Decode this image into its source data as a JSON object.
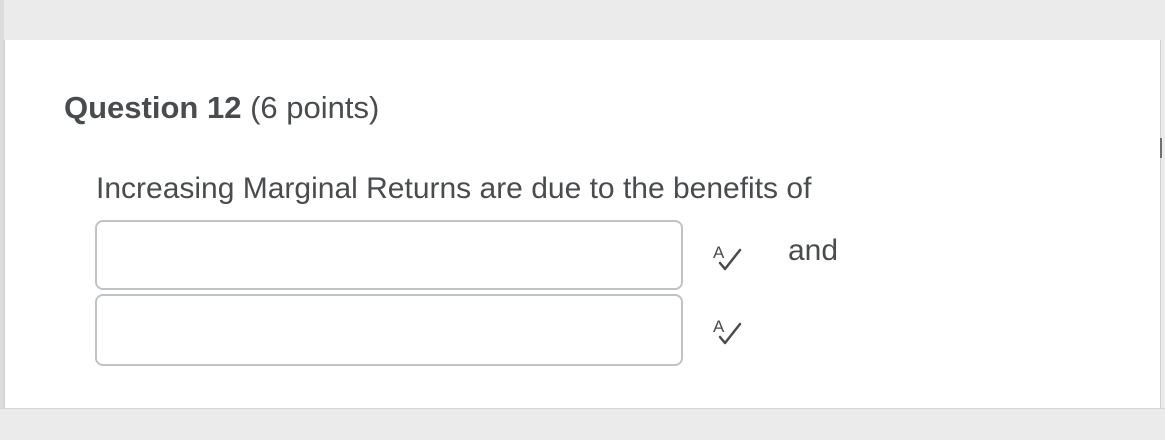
{
  "question": {
    "number_label": "Question 12",
    "points_label": "(6 points)",
    "prompt": "Increasing Marginal Returns are due to the benefits of",
    "joiner": "and",
    "blanks": [
      {
        "value": "",
        "placeholder": "",
        "icon": "spell-check-icon"
      },
      {
        "value": "",
        "placeholder": "",
        "icon": "spell-check-icon"
      }
    ]
  },
  "colors": {
    "text": "#494c4e",
    "input_border": "#bfc3c6",
    "page_background": "#ebebeb",
    "card_background": "#ffffff"
  }
}
